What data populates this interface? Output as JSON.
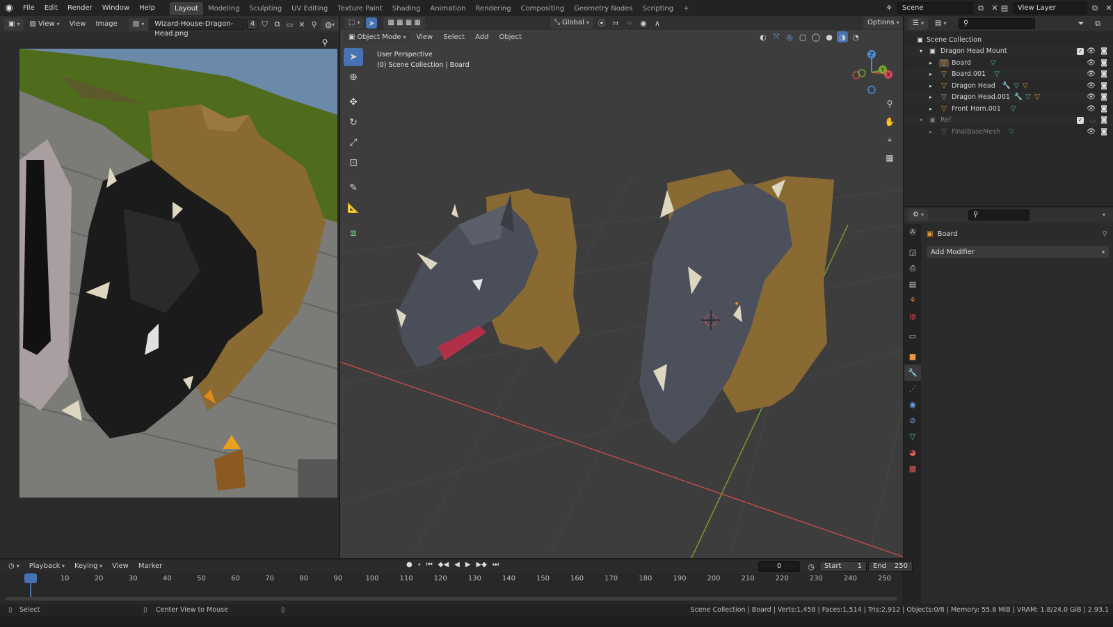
{
  "menubar": {
    "items": [
      "File",
      "Edit",
      "Render",
      "Window",
      "Help"
    ],
    "workspaces": [
      "Layout",
      "Modeling",
      "Sculpting",
      "UV Editing",
      "Texture Paint",
      "Shading",
      "Animation",
      "Rendering",
      "Compositing",
      "Geometry Nodes",
      "Scripting"
    ],
    "active_workspace": "Layout",
    "add_tab": "+",
    "scene_label": "Scene",
    "view_layer_label": "View Layer"
  },
  "image_editor": {
    "menus": [
      "View",
      "View",
      "Image"
    ],
    "image_name": "Wizard-House-Dragon-Head.png",
    "users_count": "4"
  },
  "viewport": {
    "mode": "Object Mode",
    "menus": [
      "View",
      "Select",
      "Add",
      "Object"
    ],
    "orientation": "Global",
    "options_label": "Options",
    "overlay_line1": "User Perspective",
    "overlay_line2": "(0) Scene Collection | Board",
    "gizmo_axes": {
      "x": "X",
      "y": "Y",
      "z": "Z"
    }
  },
  "outliner": {
    "root": "Scene Collection",
    "rows": [
      {
        "label": "Dragon Head Mount"
      },
      {
        "label": "Board"
      },
      {
        "label": "Board.001"
      },
      {
        "label": "Dragon Head"
      },
      {
        "label": "Dragon Head.001"
      },
      {
        "label": "Front Horn.001"
      },
      {
        "label": "Ref"
      },
      {
        "label": "FinalBaseMesh"
      }
    ]
  },
  "properties": {
    "object_name": "Board",
    "add_modifier_label": "Add Modifier"
  },
  "timeline": {
    "menus": [
      "Playback",
      "Keying",
      "View",
      "Marker"
    ],
    "current_frame": "0",
    "start_label": "Start",
    "start_value": "1",
    "end_label": "End",
    "end_value": "250",
    "ticks": [
      "0",
      "10",
      "20",
      "30",
      "40",
      "50",
      "60",
      "70",
      "80",
      "90",
      "100",
      "110",
      "120",
      "130",
      "140",
      "150",
      "160",
      "170",
      "180",
      "190",
      "200",
      "210",
      "220",
      "230",
      "240",
      "250"
    ]
  },
  "statusbar": {
    "left_action": "Select",
    "middle_action": "Center View to Mouse",
    "stats": "Scene Collection | Board | Verts:1,458 | Faces:1,514 | Tris:2,912 | Objects:0/8 | Memory: 55.8 MiB | VRAM: 1.8/24.0 GiB | 2.93.1"
  },
  "colors": {
    "accent": "#4772b3",
    "object_orange": "#e89a3a",
    "mesh_green": "#48c28a",
    "x_axis": "#c64a4a",
    "y_axis": "#7aa52e"
  }
}
